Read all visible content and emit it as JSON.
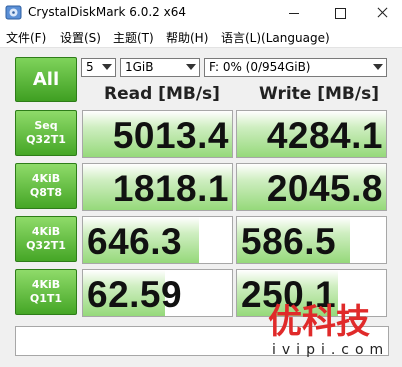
{
  "window": {
    "title": "CrystalDiskMark 6.0.2 x64",
    "icon": "disk-app-icon"
  },
  "menu": [
    {
      "label": "文件(F)"
    },
    {
      "label": "设置(S)"
    },
    {
      "label": "主题(T)"
    },
    {
      "label": "帮助(H)"
    },
    {
      "label": "语言(L)(Language)"
    }
  ],
  "controls": {
    "all_label": "All",
    "test_count": "5",
    "test_size": "1GiB",
    "drive": "F: 0% (0/954GiB)"
  },
  "headers": {
    "read": "Read [MB/s]",
    "write": "Write [MB/s]"
  },
  "tests": [
    {
      "line1": "Seq",
      "line2": "Q32T1",
      "read": "5013.4",
      "write": "4284.1",
      "read_fill": 1.0,
      "write_fill": 1.0
    },
    {
      "line1": "4KiB",
      "line2": "Q8T8",
      "read": "1818.1",
      "write": "2045.8",
      "read_fill": 1.0,
      "write_fill": 1.0
    },
    {
      "line1": "4KiB",
      "line2": "Q32T1",
      "read": "646.3",
      "write": "586.5",
      "read_fill": 0.78,
      "write_fill": 0.76
    },
    {
      "line1": "4KiB",
      "line2": "Q1T1",
      "read": "62.59",
      "write": "250.1",
      "read_fill": 0.55,
      "write_fill": 0.68
    }
  ],
  "comment": "",
  "watermark": {
    "brand": "优科技",
    "site": "ivipi.com"
  },
  "colors": {
    "button_green": "#45a626",
    "bar_green": "#95d97a",
    "watermark_red": "#e02a2a"
  }
}
